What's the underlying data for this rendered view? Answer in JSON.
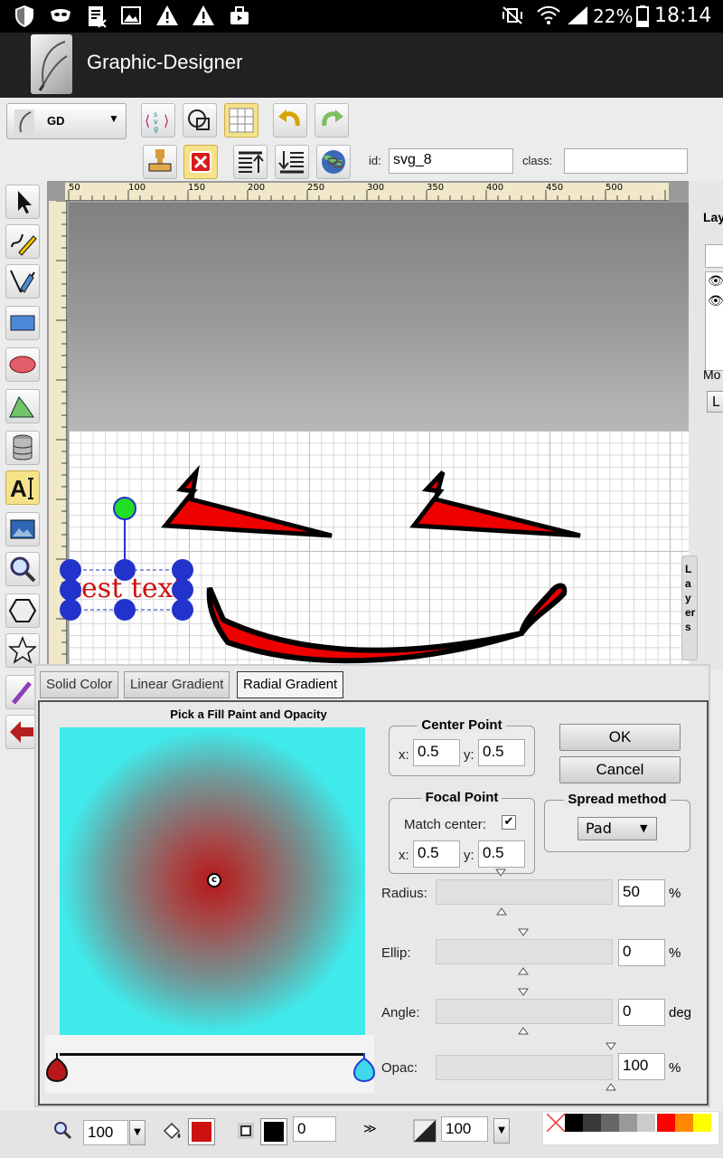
{
  "status_bar": {
    "battery": "22%",
    "time": "18:14"
  },
  "app": {
    "title": "Graphic-Designer"
  },
  "toolbar": {
    "mode_select": "GD",
    "id_label": "id:",
    "id_value": "svg_8",
    "class_label": "class:",
    "class_value": ""
  },
  "canvas": {
    "ruler_top_ticks": [
      "50",
      "100",
      "150",
      "200",
      "250",
      "300",
      "350",
      "400",
      "450",
      "500"
    ],
    "ruler_left_ticks": [
      "2",
      "1 5 0",
      "1 0 0",
      "5 0",
      "0",
      "5 0",
      "1 0"
    ],
    "text_element": "test text",
    "side_tab": "Layers",
    "layers_header": "Lay",
    "layers_footer": "Mo",
    "layers_button": "L"
  },
  "fill_dialog": {
    "tabs": [
      "Solid Color",
      "Linear Gradient",
      "Radial Gradient"
    ],
    "active_tab": "Radial Gradient",
    "heading": "Pick a Fill Paint and Opacity",
    "center_point": {
      "title": "Center Point",
      "x_label": "x:",
      "x": "0.5",
      "y_label": "y:",
      "y": "0.5"
    },
    "focal_point": {
      "title": "Focal Point",
      "match_center_label": "Match center:",
      "match_center_checked": true,
      "x_label": "x:",
      "x": "0.5",
      "y_label": "y:",
      "y": "0.5"
    },
    "spread": {
      "title": "Spread method",
      "value": "Pad"
    },
    "ok": "OK",
    "cancel": "Cancel",
    "center_marker": "c",
    "sliders": [
      {
        "label": "Radius:",
        "value": "50",
        "unit": "%"
      },
      {
        "label": "Ellip:",
        "value": "0",
        "unit": "%"
      },
      {
        "label": "Angle:",
        "value": "0",
        "unit": "deg"
      },
      {
        "label": "Opac:",
        "value": "100",
        "unit": "%"
      }
    ],
    "gradient_stops": [
      {
        "color": "#b81818"
      },
      {
        "color": "#40eaea"
      }
    ]
  },
  "bottom_bar": {
    "zoom": "100",
    "fill_color": "#cc1111",
    "stroke_color": "#000000",
    "stroke_width": "0",
    "opacity": "100",
    "palette": [
      "#000000",
      "#3a3a3a",
      "#666666",
      "#999999",
      "#cccccc",
      "#ffffff",
      "#ff0000",
      "#ff8800",
      "#ffff00"
    ]
  }
}
